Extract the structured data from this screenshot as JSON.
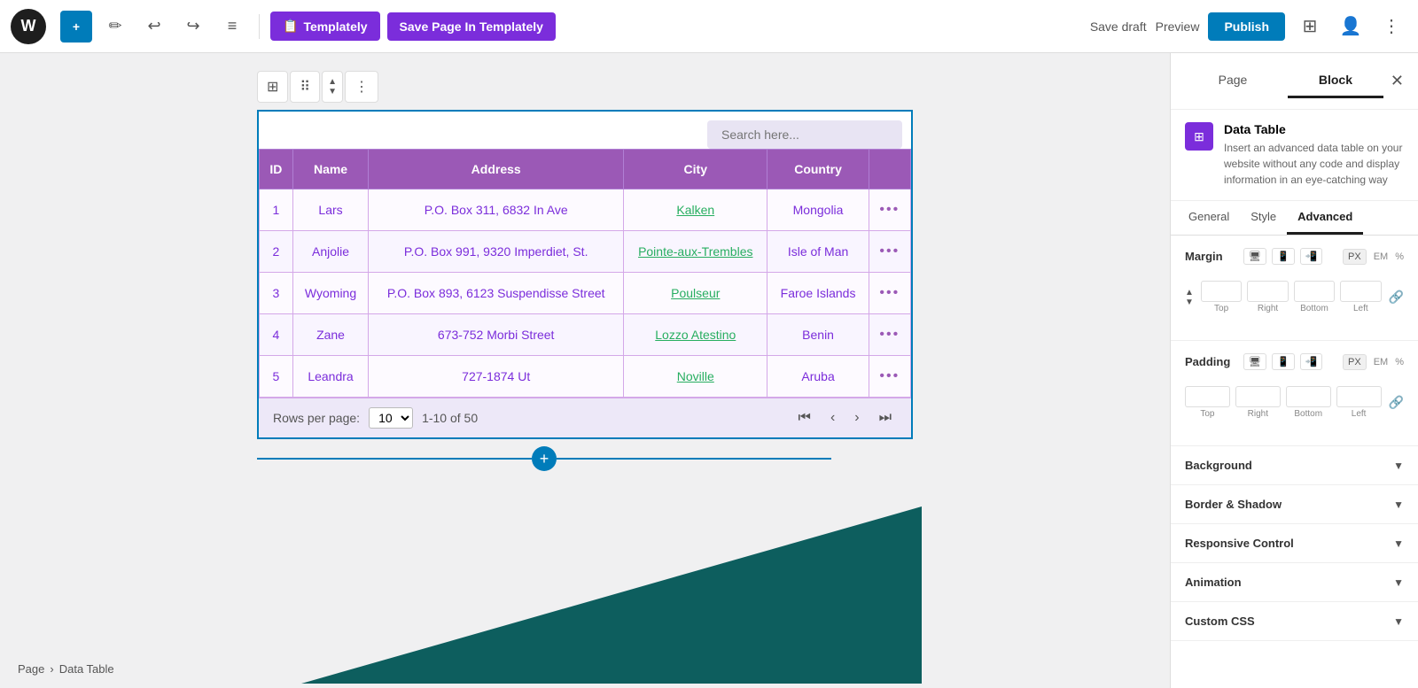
{
  "topbar": {
    "add_btn": "+",
    "edit_icon": "✏",
    "undo_icon": "↩",
    "redo_icon": "↪",
    "list_icon": "≡",
    "templately_label": "Templately",
    "save_templately_label": "Save Page In Templately",
    "save_draft_label": "Save draft",
    "preview_label": "Preview",
    "publish_label": "Publish",
    "layout_icon": "⊞",
    "user_icon": "👤",
    "more_icon": "⋮"
  },
  "sidebar_page_tab": "Page",
  "sidebar_block_tab": "Block",
  "block_title": "Data Table",
  "block_description": "Insert an advanced data table on your website without any code and display information in an eye-catching way",
  "panel_tabs": {
    "general": "General",
    "style": "Style",
    "advanced": "Advanced"
  },
  "margin": {
    "label": "Margin",
    "units": [
      "PX",
      "EM",
      "%"
    ],
    "fields": {
      "top": "",
      "right": "",
      "bottom": "",
      "left": ""
    },
    "labels": [
      "Top",
      "Right",
      "Bottom",
      "Left"
    ]
  },
  "padding": {
    "label": "Padding",
    "units": [
      "PX",
      "EM",
      "%"
    ],
    "fields": {
      "top": "",
      "right": "",
      "bottom": "",
      "left": ""
    },
    "labels": [
      "Top",
      "Right",
      "Bottom",
      "Left"
    ]
  },
  "collapsible_sections": [
    {
      "id": "background",
      "label": "Background"
    },
    {
      "id": "border-shadow",
      "label": "Border & Shadow"
    },
    {
      "id": "responsive-control",
      "label": "Responsive Control"
    },
    {
      "id": "animation",
      "label": "Animation"
    },
    {
      "id": "custom-css",
      "label": "Custom CSS"
    }
  ],
  "table": {
    "search_placeholder": "Search here...",
    "headers": [
      "ID",
      "Name",
      "Address",
      "City",
      "Country",
      ""
    ],
    "rows": [
      {
        "id": "1",
        "name": "Lars",
        "address": "P.O. Box 311, 6832 In Ave",
        "city": "Kalken",
        "country": "Mongolia",
        "dots": "•••"
      },
      {
        "id": "2",
        "name": "Anjolie",
        "address": "P.O. Box 991, 9320 Imperdiet, St.",
        "city": "Pointe-aux-Trembles",
        "country": "Isle of Man",
        "dots": "•••"
      },
      {
        "id": "3",
        "name": "Wyoming",
        "address": "P.O. Box 893, 6123 Suspendisse Street",
        "city": "Poulseur",
        "country": "Faroe Islands",
        "dots": "•••"
      },
      {
        "id": "4",
        "name": "Zane",
        "address": "673-752 Morbi Street",
        "city": "Lozzo Atestino",
        "country": "Benin",
        "dots": "•••"
      },
      {
        "id": "5",
        "name": "Leandra",
        "address": "727-1874 Ut",
        "city": "Noville",
        "country": "Aruba",
        "dots": "•••"
      }
    ],
    "pagination": {
      "rows_per_page_label": "Rows per page:",
      "rows_per_page_value": "10",
      "page_info": "1-10 of 50",
      "first_btn": "⏮",
      "prev_btn": "‹",
      "next_btn": "›",
      "last_btn": "⏭"
    }
  },
  "breadcrumb": {
    "page": "Page",
    "separator": "›",
    "current": "Data Table"
  }
}
